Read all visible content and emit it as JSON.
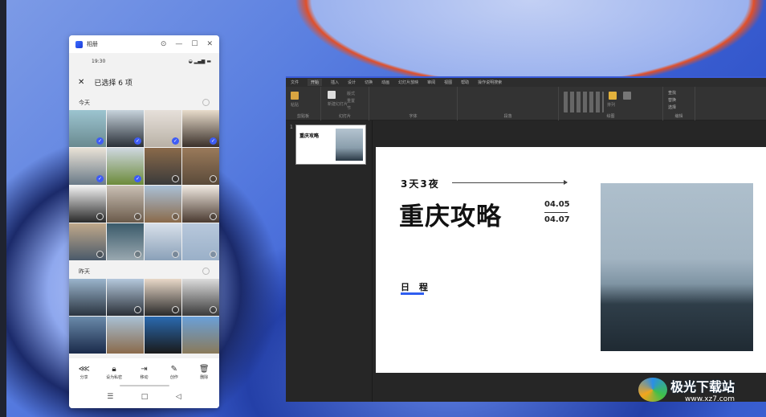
{
  "phone": {
    "app_title": "相册",
    "time": "19:30",
    "header": "已选择 6 项",
    "sections": [
      {
        "label": "今天"
      },
      {
        "label": "昨天"
      }
    ],
    "actions": [
      {
        "label": "分享",
        "icon": "share-icon"
      },
      {
        "label": "设为私密",
        "icon": "lock-icon"
      },
      {
        "label": "移动",
        "icon": "move-icon"
      },
      {
        "label": "创作",
        "icon": "edit-icon"
      },
      {
        "label": "删除",
        "icon": "trash-icon"
      }
    ],
    "today_photos": [
      {
        "c1": "#9cc4d0",
        "c2": "#6a8a90",
        "sel": true
      },
      {
        "c1": "#c7d3dc",
        "c2": "#2a3038",
        "sel": true
      },
      {
        "c1": "#e6e0da",
        "c2": "#b9b1a6",
        "sel": true
      },
      {
        "c1": "#e8dccb",
        "c2": "#3a302a",
        "sel": true
      },
      {
        "c1": "#e9e2d6",
        "c2": "#6a7a88",
        "sel": true
      },
      {
        "c1": "#cfd8e0",
        "c2": "#6c8a3a",
        "sel": true
      },
      {
        "c1": "#8a6a4a",
        "c2": "#3a3a3a",
        "sel": false
      },
      {
        "c1": "#9a7a5a",
        "c2": "#5a4a3a",
        "sel": false
      },
      {
        "c1": "#f2f2f2",
        "c2": "#2a2a2a",
        "sel": false
      },
      {
        "c1": "#c9bfb4",
        "c2": "#6a5a4a",
        "sel": false
      },
      {
        "c1": "#aac0d6",
        "c2": "#8a6a4a",
        "sel": false
      },
      {
        "c1": "#efe8e0",
        "c2": "#4a3a30",
        "sel": false
      },
      {
        "c1": "#c0a88a",
        "c2": "#4a5a6a",
        "sel": false
      },
      {
        "c1": "#3a5a6a",
        "c2": "#9aa8b0",
        "sel": false
      },
      {
        "c1": "#d8e0ea",
        "c2": "#8aa0b8",
        "sel": false
      },
      {
        "c1": "#b8c8dc",
        "c2": "#9ab0c8",
        "sel": false
      }
    ],
    "yesterday_photos": [
      {
        "c1": "#9ab4cc",
        "c2": "#2a3440"
      },
      {
        "c1": "#b4c8dc",
        "c2": "#2a3038"
      },
      {
        "c1": "#e8d8c8",
        "c2": "#2a2a2a"
      },
      {
        "c1": "#dcdcdc",
        "c2": "#3a3a3a"
      },
      {
        "c1": "#6a8aaa",
        "c2": "#1a2a4a"
      },
      {
        "c1": "#a8c0d4",
        "c2": "#8a6a4a"
      },
      {
        "c1": "#2a6ab0",
        "c2": "#1a1a1a"
      },
      {
        "c1": "#6aa0d8",
        "c2": "#8a7a5a"
      }
    ]
  },
  "ppt": {
    "tabs": [
      "文件",
      "开始",
      "插入",
      "设计",
      "切换",
      "动画",
      "幻灯片放映",
      "审阅",
      "视图",
      "帮助",
      "操作说明搜索"
    ],
    "active_tab": "开始",
    "groups": [
      "剪贴板",
      "幻灯片",
      "字体",
      "段落",
      "绘图",
      "编辑"
    ],
    "buttons": {
      "paste": "粘贴",
      "new_slide": "新建幻灯片",
      "layout": "版式",
      "reset": "重置",
      "section": "节",
      "arrange": "排列",
      "find": "查找",
      "replace": "替换",
      "select": "选择"
    },
    "slide_number": "1",
    "slide": {
      "subtitle": "3天3夜",
      "title": "重庆攻略",
      "date_start": "04.05",
      "date_end": "04.07",
      "schedule": "日 程"
    }
  },
  "watermark": {
    "name": "极光下载站",
    "url": "www.xz7.com"
  }
}
